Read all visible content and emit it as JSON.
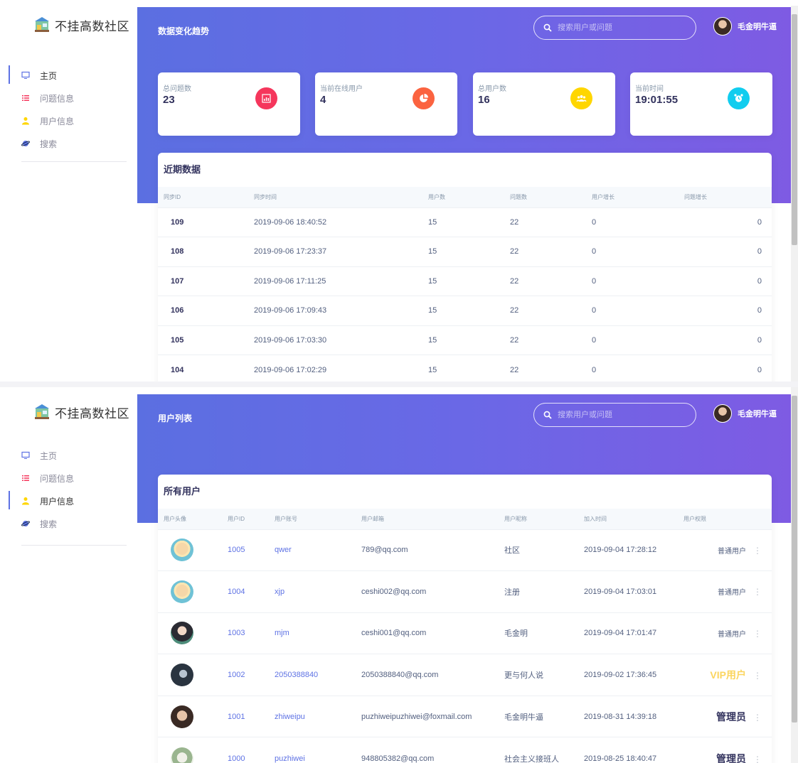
{
  "brand": {
    "name": "不挂高数社区"
  },
  "colors": {
    "accent": "#5e72e4",
    "vip": "#fbd55f",
    "icon_red": "#f5365c",
    "icon_orange": "#fb6340",
    "icon_yellow": "#ffd600",
    "icon_cyan": "#11cdef"
  },
  "nav": [
    {
      "label": "主页",
      "icon": "monitor-icon"
    },
    {
      "label": "问题信息",
      "icon": "list-icon"
    },
    {
      "label": "用户信息",
      "icon": "user-icon"
    },
    {
      "label": "搜索",
      "icon": "search-planet-icon"
    }
  ],
  "header": {
    "search_placeholder": "搜索用户或问题",
    "username": "毛金明牛逼"
  },
  "dashboard": {
    "page_title": "数据变化趋势",
    "stats": [
      {
        "label": "总问题数",
        "value": "23",
        "icon": "chart-bar-icon"
      },
      {
        "label": "当前在线用户",
        "value": "4",
        "icon": "chart-pie-icon"
      },
      {
        "label": "总用户数",
        "value": "16",
        "icon": "users-icon"
      },
      {
        "label": "当前时间",
        "value": "19:01:55",
        "icon": "alarm-clock-icon"
      }
    ],
    "recent_title": "近期数据",
    "columns": [
      "同步ID",
      "同步时间",
      "用户数",
      "问题数",
      "用户增长",
      "问题增长"
    ],
    "rows": [
      {
        "id": "109",
        "time": "2019-09-06 18:40:52",
        "users": "15",
        "questions": "22",
        "user_growth": "0",
        "question_growth": "0"
      },
      {
        "id": "108",
        "time": "2019-09-06 17:23:37",
        "users": "15",
        "questions": "22",
        "user_growth": "0",
        "question_growth": "0"
      },
      {
        "id": "107",
        "time": "2019-09-06 17:11:25",
        "users": "15",
        "questions": "22",
        "user_growth": "0",
        "question_growth": "0"
      },
      {
        "id": "106",
        "time": "2019-09-06 17:09:43",
        "users": "15",
        "questions": "22",
        "user_growth": "0",
        "question_growth": "0"
      },
      {
        "id": "105",
        "time": "2019-09-06 17:03:30",
        "users": "15",
        "questions": "22",
        "user_growth": "0",
        "question_growth": "0"
      },
      {
        "id": "104",
        "time": "2019-09-06 17:02:29",
        "users": "15",
        "questions": "22",
        "user_growth": "0",
        "question_growth": "0"
      }
    ]
  },
  "users_page": {
    "page_title": "用户列表",
    "card_title": "所有用户",
    "columns": [
      "用户头像",
      "用户ID",
      "用户账号",
      "用户邮箱",
      "用户昵称",
      "加入时间",
      "用户权限"
    ],
    "rows": [
      {
        "id": "1005",
        "account": "qwer",
        "email": "789@qq.com",
        "nickname": "社区",
        "joined": "2019-09-04 17:28:12",
        "role": "普通用户",
        "role_type": "normal"
      },
      {
        "id": "1004",
        "account": "xjp",
        "email": "ceshi002@qq.com",
        "nickname": "注册",
        "joined": "2019-09-04 17:03:01",
        "role": "普通用户",
        "role_type": "normal"
      },
      {
        "id": "1003",
        "account": "mjm",
        "email": "ceshi001@qq.com",
        "nickname": "毛金明",
        "joined": "2019-09-04 17:01:47",
        "role": "普通用户",
        "role_type": "normal"
      },
      {
        "id": "1002",
        "account": "2050388840",
        "email": "2050388840@qq.com",
        "nickname": "更与何人说",
        "joined": "2019-09-02 17:36:45",
        "role": "VIP用户",
        "role_type": "vip"
      },
      {
        "id": "1001",
        "account": "zhiweipu",
        "email": "puzhiweipuzhiwei@foxmail.com",
        "nickname": "毛金明牛逼",
        "joined": "2019-08-31 14:39:18",
        "role": "管理员",
        "role_type": "admin"
      },
      {
        "id": "1000",
        "account": "puzhiwei",
        "email": "948805382@qq.com",
        "nickname": "社会主义接班人",
        "joined": "2019-08-25 18:40:47",
        "role": "管理员",
        "role_type": "admin"
      }
    ],
    "more_icon": "more-vertical-icon"
  }
}
